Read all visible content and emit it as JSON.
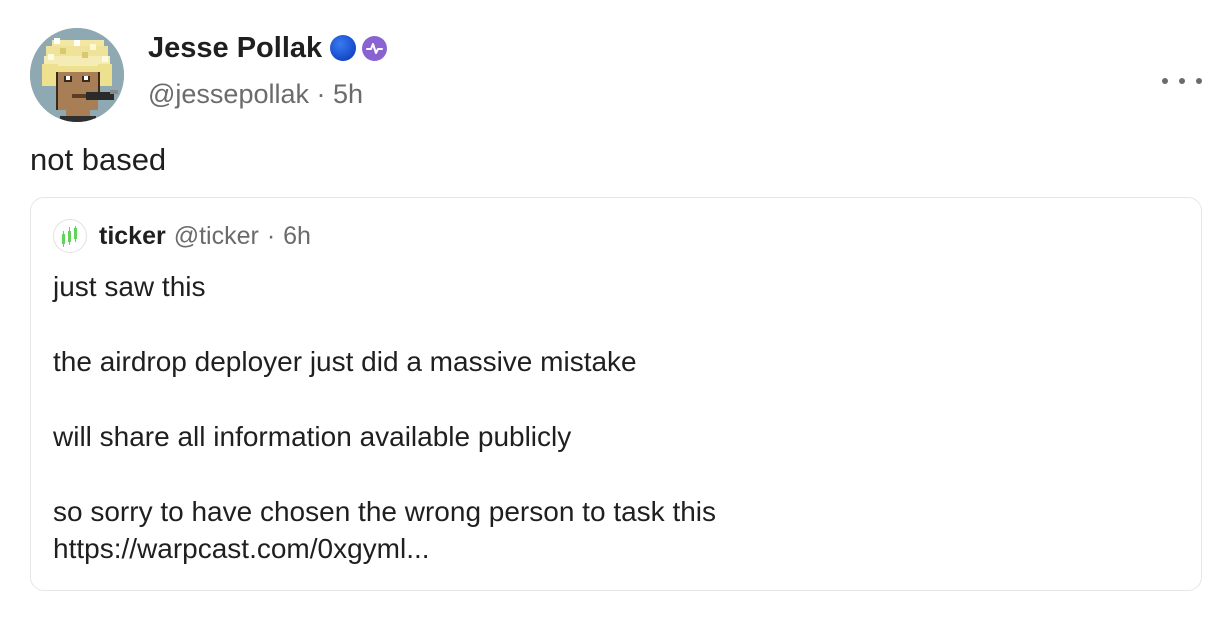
{
  "cast": {
    "author": {
      "display_name": "Jesse Pollak",
      "handle": "@jessepollak",
      "time": "5h",
      "separator": "·"
    },
    "text": "not based",
    "quote": {
      "author_name": "ticker",
      "author_handle": "@ticker",
      "separator": "·",
      "time": "6h",
      "lines": [
        "just saw this",
        "the airdrop deployer just did a massive mistake",
        "will share all information available publicly",
        "so sorry to have chosen the wrong person to task this",
        "https://warpcast.com/0xgyml..."
      ]
    }
  },
  "colors": {
    "power_badge": "#8a63d2",
    "blue_dot": "#1448c9",
    "ticker_green": "#5fd35a"
  },
  "icons": {
    "blue_dot": "blue-circle-icon",
    "power_badge": "power-badge-icon",
    "more": "more-horizontal-icon",
    "ticker_avatar": "candlestick-chart-icon"
  }
}
